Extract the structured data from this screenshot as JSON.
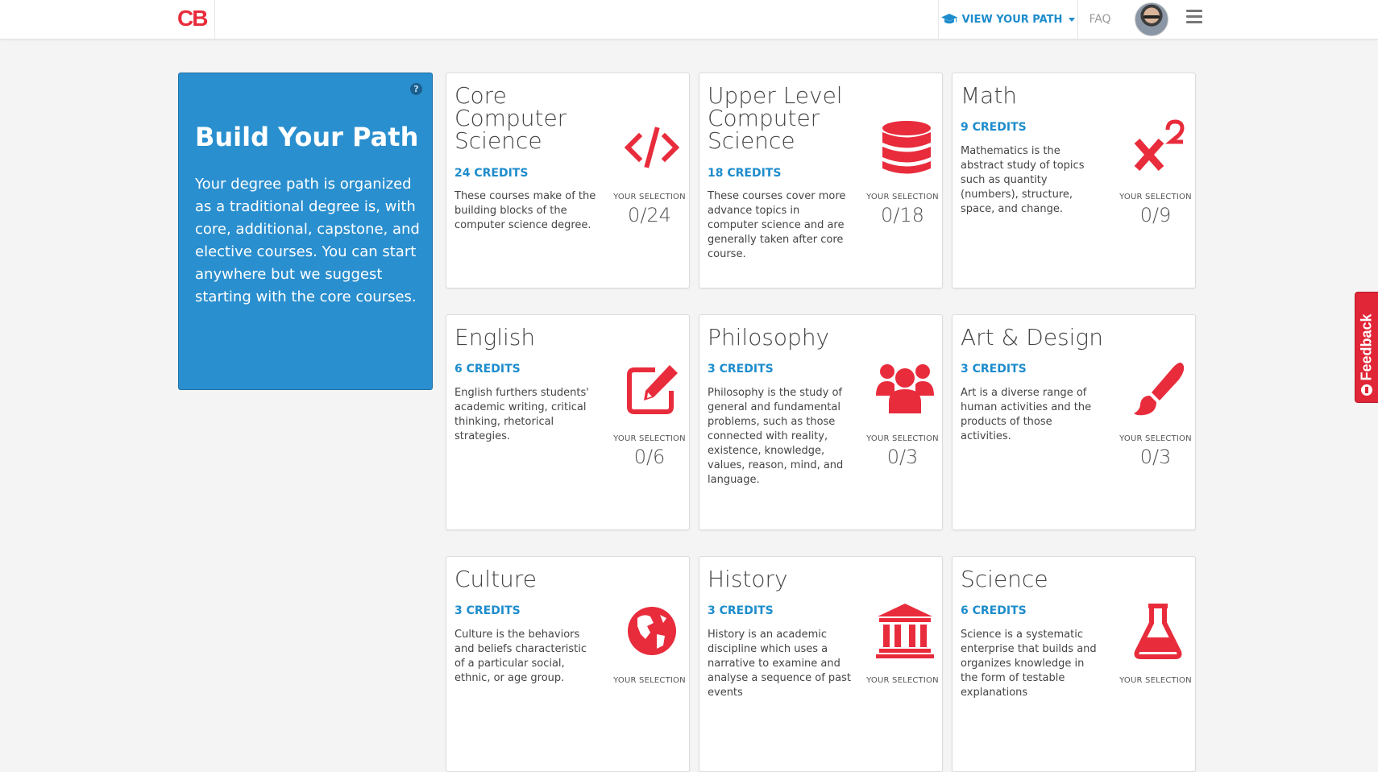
{
  "nav": {
    "logo": "CB",
    "view_path_label": "VIEW YOUR PATH",
    "faq_label": "FAQ"
  },
  "intro": {
    "help": "?",
    "title": "Build Your Path",
    "text": "Your degree path is organized as a traditional degree is, with core, additional, capstone, and elective courses. You can start anywhere but we suggest starting with the core courses."
  },
  "selection_label": "YOUR SELECTION",
  "cards": [
    {
      "title": "Core Computer Science",
      "credits": "24 CREDITS",
      "desc": "These courses make of the building blocks of the computer science degree.",
      "selection": "0/24",
      "icon": "code-icon"
    },
    {
      "title": "Upper Level Computer Science",
      "credits": "18 CREDITS",
      "desc": "These courses cover more advance topics in computer science and are generally taken after core course.",
      "selection": "0/18",
      "icon": "database-icon"
    },
    {
      "title": "Math",
      "credits": "9 CREDITS",
      "desc": "Mathematics is the abstract study of topics such as quantity (numbers), structure, space, and change.",
      "selection": "0/9",
      "icon": "superscript-icon"
    },
    {
      "title": "English",
      "credits": "6 CREDITS",
      "desc": "English furthers students' academic writing, critical thinking, rhetorical strategies.",
      "selection": "0/6",
      "icon": "edit-icon"
    },
    {
      "title": "Philosophy",
      "credits": "3 CREDITS",
      "desc": "Philosophy is the study of general and fundamental problems, such as those connected with reality, existence, knowledge, values, reason, mind, and language.",
      "selection": "0/3",
      "icon": "users-icon"
    },
    {
      "title": "Art & Design",
      "credits": "3 CREDITS",
      "desc": "Art is a diverse range of human activities and the products of those activities.",
      "selection": "0/3",
      "icon": "paintbrush-icon"
    },
    {
      "title": "Culture",
      "credits": "3 CREDITS",
      "desc": "Culture is the behaviors and beliefs characteristic of a particular social, ethnic, or age group.",
      "selection": "",
      "icon": "globe-icon"
    },
    {
      "title": "History",
      "credits": "3 CREDITS",
      "desc": "History is an academic discipline which uses a narrative to examine and analyse a sequence of past events",
      "selection": "",
      "icon": "institution-icon"
    },
    {
      "title": "Science",
      "credits": "6 CREDITS",
      "desc": "Science is a systematic enterprise that builds and organizes knowledge in the form of testable explanations",
      "selection": "",
      "icon": "flask-icon"
    }
  ],
  "feedback_label": "Feedback",
  "colors": {
    "accent_blue": "#1d8ccc",
    "icon_red": "#e82c3c",
    "intro_bg": "#2a8fcf"
  }
}
